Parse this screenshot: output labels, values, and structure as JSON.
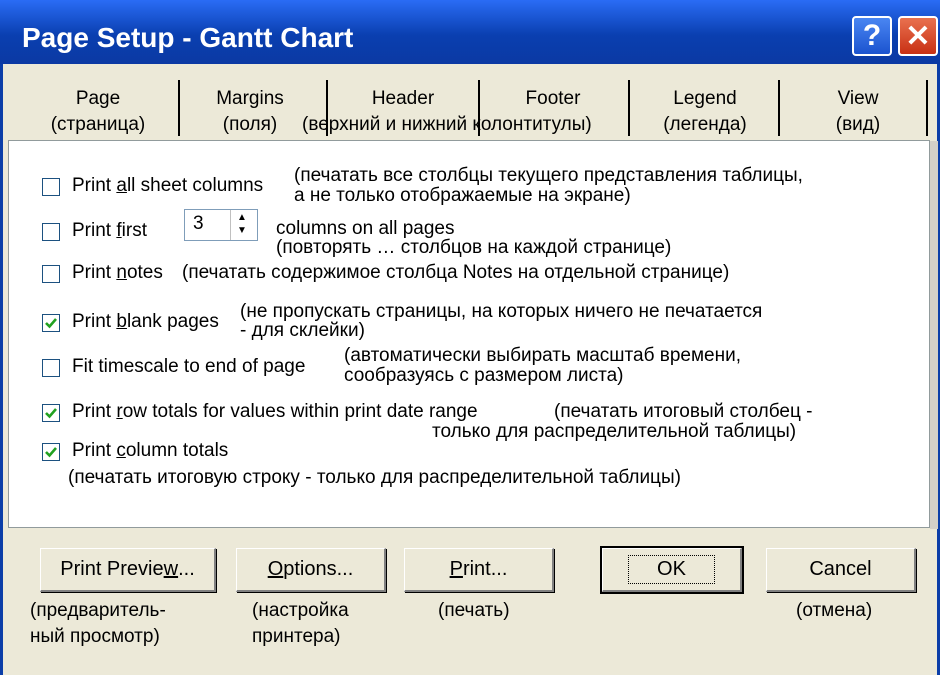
{
  "window": {
    "title": "Page Setup - Gantt Chart",
    "help_icon": "?",
    "close_icon": "✕",
    "accent": "#0a3fb0"
  },
  "tabs": [
    {
      "label": "Page",
      "sub": "(страница)"
    },
    {
      "label": "Margins",
      "sub": "(поля)"
    },
    {
      "label": "Header",
      "sub": "(верхний и нижний колонтитулы)"
    },
    {
      "label": "Footer",
      "sub": ""
    },
    {
      "label": "Legend",
      "sub": "(легенда)"
    },
    {
      "label": "View",
      "sub": "(вид)"
    }
  ],
  "options": {
    "print_all_columns": {
      "checked": false,
      "label_pre": "Print ",
      "label_u": "a",
      "label_post": "ll sheet columns",
      "note1": "(печатать все столбцы текущего представления таблицы,",
      "note2": "а не только отображаемые на экране)"
    },
    "print_first": {
      "checked": false,
      "label_pre": "Print ",
      "label_u": "f",
      "label_post": "irst",
      "value": "3",
      "suffix": "columns on all pages",
      "note": "(повторять … столбцов на каждой странице)"
    },
    "print_notes": {
      "checked": false,
      "label_pre": "Print ",
      "label_u": "n",
      "label_post": "otes",
      "note": "(печатать содержимое столбца Notes на отдельной странице)"
    },
    "print_blank_pages": {
      "checked": true,
      "label_pre": "Print ",
      "label_u": "b",
      "label_post": "lank pages",
      "note1": "(не пропускать страницы, на которых ничего не печатается",
      "note2": "- для склейки)"
    },
    "fit_timescale": {
      "checked": false,
      "label_pre": "Fit timescale to end of pa",
      "label_u": "g",
      "label_post": "e",
      "note1": "(автоматически выбирать масштаб времени,",
      "note2": "сообразуясь с размером листа)"
    },
    "print_row_totals": {
      "checked": true,
      "label_pre": "Print ",
      "label_u": "r",
      "label_post": "ow totals for values within print date range",
      "note1": "(печатать итоговый столбец -",
      "note2": "только для распределительной таблицы)"
    },
    "print_column_totals": {
      "checked": true,
      "label_pre": "Print ",
      "label_u": "c",
      "label_post": "olumn totals",
      "note": "(печатать итоговую строку - только для распределительной таблицы)"
    }
  },
  "buttons": {
    "print_preview": {
      "label_pre": "Print Previe",
      "label_u": "w",
      "label_post": "...",
      "caption1": "(предваритель-",
      "caption2": "ный просмотр)"
    },
    "options": {
      "label_pre": "",
      "label_u": "O",
      "label_post": "ptions...",
      "caption1": "(настройка",
      "caption2": "принтера)"
    },
    "print": {
      "label_pre": "",
      "label_u": "P",
      "label_post": "rint...",
      "caption1": "(печать)"
    },
    "ok": {
      "label": "OK"
    },
    "cancel": {
      "label": "Cancel",
      "caption1": "(отмена)"
    }
  }
}
